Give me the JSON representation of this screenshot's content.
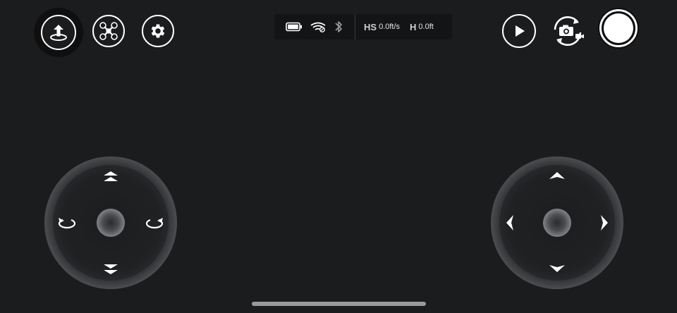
{
  "top_left": {
    "takeoff_icon": "takeoff-arrow-icon",
    "drone_icon": "drone-icon",
    "settings_icon": "gear-icon"
  },
  "status": {
    "battery_icon": "battery-icon",
    "wifi_icon": "wifi-icon",
    "bluetooth_icon": "bluetooth-icon",
    "horizontal_speed_label": "HS",
    "horizontal_speed_value": "0.0ft/s",
    "height_label": "H",
    "height_value": "0.0ft"
  },
  "top_right": {
    "playback_icon": "play-icon",
    "camera_switch_icon": "camera-switch-icon",
    "shutter_icon": "shutter-button"
  },
  "colors": {
    "background": "#1b1c1e",
    "status_bar": "#131416",
    "foreground": "#ffffff"
  }
}
